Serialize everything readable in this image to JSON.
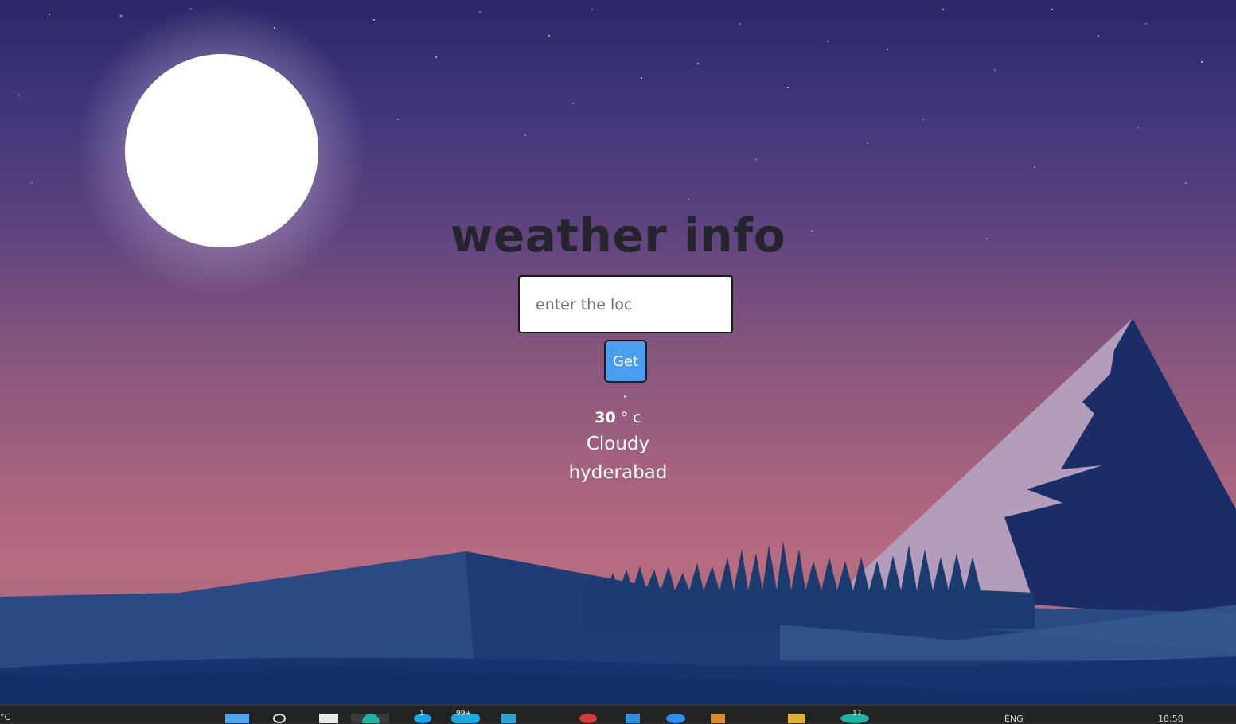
{
  "page": {
    "title": "weather info",
    "search": {
      "placeholder": "enter the loc",
      "value": ""
    },
    "button_label": "Get",
    "weather": {
      "temperature": "30",
      "unit": "° c",
      "condition": "Cloudy",
      "city": "hyderabad"
    }
  },
  "taskbar": {
    "language": "ENG",
    "time": "18:58",
    "badges": [
      "1",
      "99+",
      "17"
    ],
    "left_edge_text": "°C"
  },
  "colors": {
    "button_bg": "#4a9ef0",
    "title": "#25232b",
    "sky_top": "#2b2868",
    "sky_bottom": "#b76c80",
    "mountain": "#1f3f78"
  }
}
